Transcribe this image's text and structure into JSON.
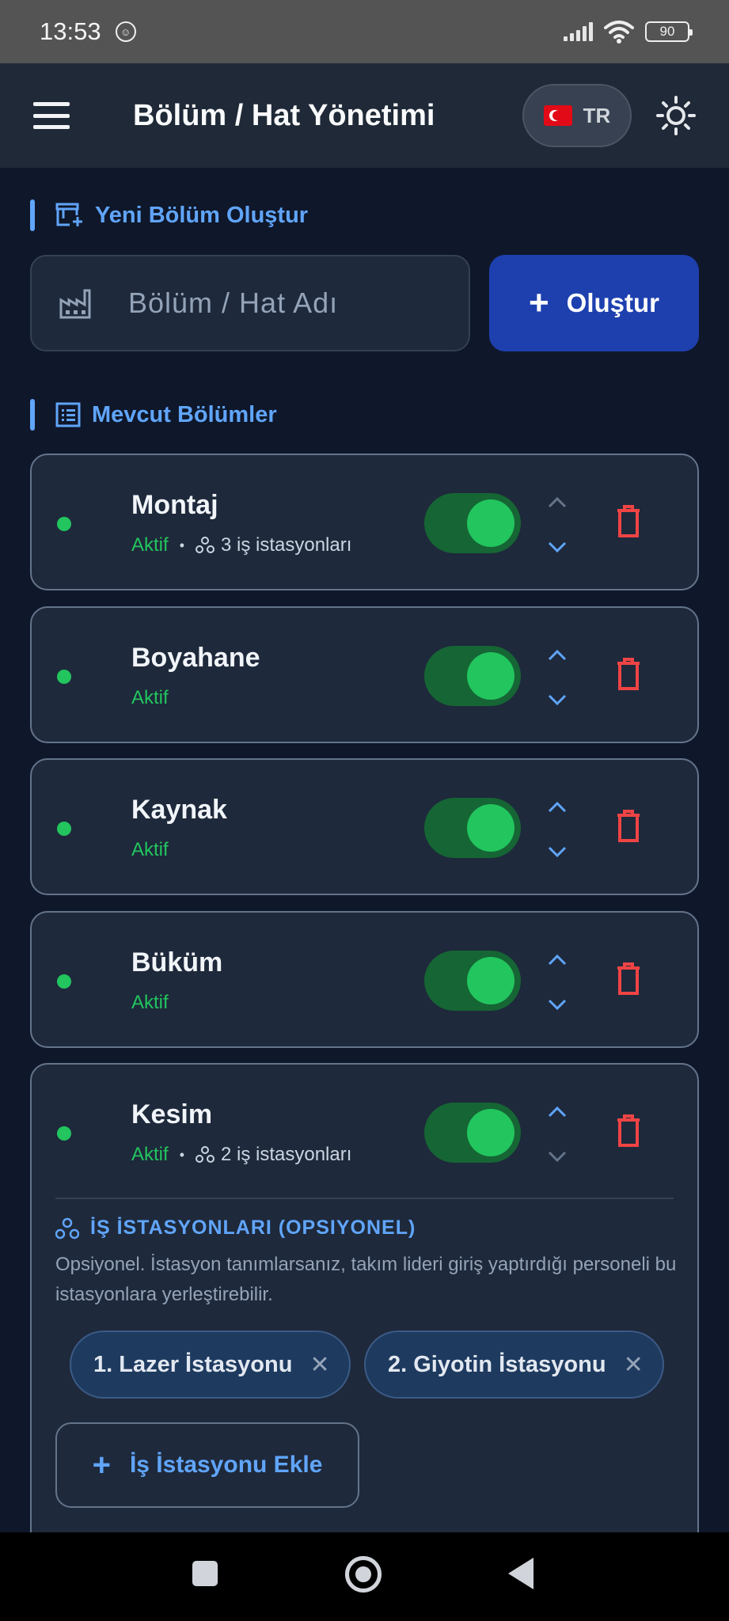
{
  "status_bar": {
    "time": "13:53",
    "battery": "90",
    "icons": [
      "notification-icon",
      "signal-icon",
      "wifi-icon",
      "battery-icon"
    ]
  },
  "app_bar": {
    "title": "Bölüm / Hat Yönetimi",
    "language_code": "TR",
    "icons": [
      "menu-icon",
      "turkey-flag-icon",
      "sun-icon"
    ]
  },
  "new_section": {
    "heading": "Yeni Bölüm Oluştur",
    "input_placeholder": "Bölüm / Hat Adı",
    "create_button": "Oluştur"
  },
  "existing_section": {
    "heading": "Mevcut Bölümler",
    "departments": [
      {
        "name": "Montaj",
        "status": "Aktif",
        "stations": "3 iş istasyonları",
        "enabled": true
      },
      {
        "name": "Boyahane",
        "status": "Aktif",
        "enabled": true
      },
      {
        "name": "Kaynak",
        "status": "Aktif",
        "enabled": true
      },
      {
        "name": "Büküm",
        "status": "Aktif",
        "enabled": true
      },
      {
        "name": "Kesim",
        "status": "Aktif",
        "stations": "2 iş istasyonları",
        "enabled": true
      }
    ]
  },
  "workstations": {
    "heading": "İŞ İSTASYONLARI (OPSIYONEL)",
    "description": "Opsiyonel. İstasyon tanımlarsanız, takım lideri giriş yaptırdığı personeli bu istasyonlara yerleştirebilir.",
    "chips": [
      "1. Lazer İstasyonu",
      "2. Giyotin İstasyonu"
    ],
    "add_button": "İş İstasyonu Ekle"
  },
  "colors": {
    "accent": "#60a5fa",
    "active": "#22c55e",
    "danger": "#ef4444",
    "primary_button": "#1e40af",
    "background": "#0f172a"
  }
}
